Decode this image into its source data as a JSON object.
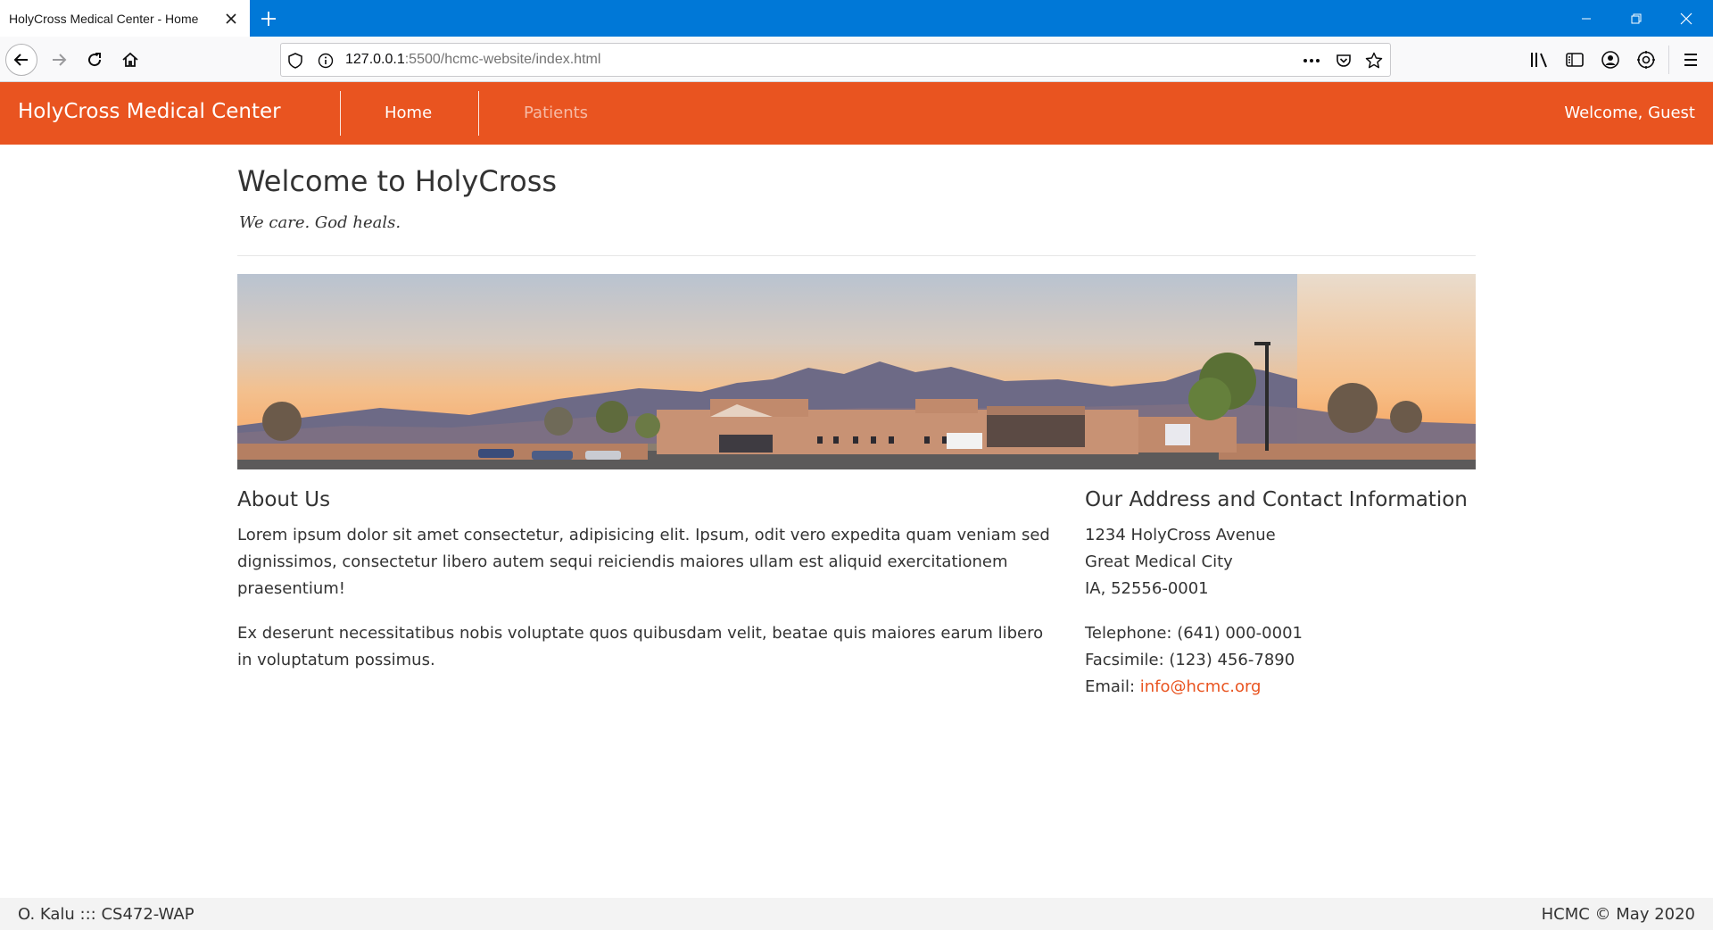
{
  "browser": {
    "tab_title": "HolyCross Medical Center - Home",
    "url_host": "127.0.0.1",
    "url_path": ":5500/hcmc-website/index.html"
  },
  "header": {
    "brand": "HolyCross Medical Center",
    "nav": [
      {
        "label": "Home",
        "state": "active"
      },
      {
        "label": "Patients",
        "state": "inactive"
      }
    ],
    "welcome": "Welcome, Guest",
    "brand_color": "#e95420"
  },
  "main": {
    "title": "Welcome to HolyCross",
    "tagline": "We care. God heals.",
    "about": {
      "heading": "About Us",
      "paragraphs": [
        "Lorem ipsum dolor sit amet consectetur, adipisicing elit. Ipsum, odit vero expedita quam veniam sed dignissimos, consectetur libero autem sequi reiciendis maiores ullam est aliquid exercitationem praesentium!",
        "Ex deserunt necessitatibus nobis voluptate quos quibusdam velit, beatae quis maiores earum libero in voluptatum possimus."
      ]
    },
    "contact": {
      "heading": "Our Address and Contact Information",
      "address": [
        "1234 HolyCross Avenue",
        "Great Medical City",
        "IA, 52556-0001"
      ],
      "telephone": "Telephone: (641) 000-0001",
      "fax": "Facsimile: (123) 456-7890",
      "email_label": "Email: ",
      "email": "info@hcmc.org"
    }
  },
  "footer": {
    "left": "O. Kalu ::: CS472-WAP",
    "right": "HCMC © May 2020"
  }
}
